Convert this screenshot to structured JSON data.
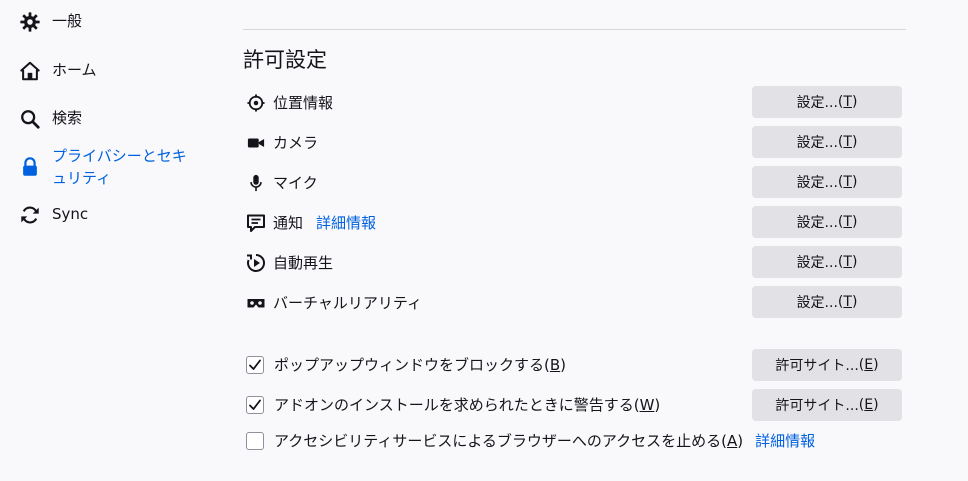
{
  "sidebar": {
    "items": [
      {
        "label": "一般",
        "icon": "gear-icon"
      },
      {
        "label": "ホーム",
        "icon": "home-icon"
      },
      {
        "label": "検索",
        "icon": "search-icon"
      },
      {
        "label": "プライバシーとセキュリティ",
        "icon": "lock-icon",
        "selected": true
      },
      {
        "label": "Sync",
        "icon": "sync-icon"
      }
    ]
  },
  "permissions": {
    "title": "許可設定",
    "rows": [
      {
        "label": "位置情報",
        "icon": "location-icon",
        "button": "設定...",
        "accesskey": "T"
      },
      {
        "label": "カメラ",
        "icon": "camera-icon",
        "button": "設定...",
        "accesskey": "T"
      },
      {
        "label": "マイク",
        "icon": "microphone-icon",
        "button": "設定...",
        "accesskey": "T"
      },
      {
        "label": "通知",
        "icon": "notification-icon",
        "link": "詳細情報",
        "button": "設定...",
        "accesskey": "T"
      },
      {
        "label": "自動再生",
        "icon": "autoplay-icon",
        "button": "設定...",
        "accesskey": "T"
      },
      {
        "label": "バーチャルリアリティ",
        "icon": "vr-icon",
        "button": "設定...",
        "accesskey": "T"
      }
    ],
    "checkboxes": [
      {
        "label": "ポップアップウィンドウをブロックする",
        "accesskey": "B",
        "checked": true,
        "button": "許可サイト...",
        "button_accesskey": "E"
      },
      {
        "label": "アドオンのインストールを求められたときに警告する",
        "accesskey": "W",
        "checked": true,
        "button": "許可サイト...",
        "button_accesskey": "E"
      },
      {
        "label": "アクセシビリティサービスによるブラウザーへのアクセスを止める",
        "accesskey": "A",
        "checked": false,
        "link": "詳細情報"
      }
    ]
  },
  "colors": {
    "accent": "#0061e0",
    "button_bg": "#e2e2e6",
    "background": "#f9f9fb"
  }
}
